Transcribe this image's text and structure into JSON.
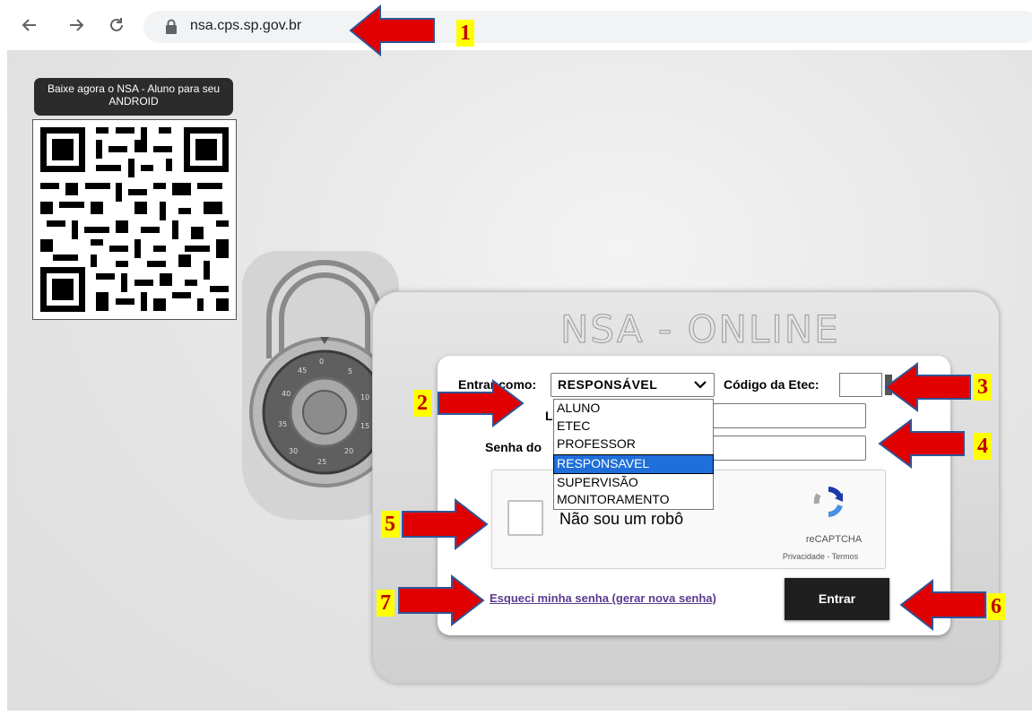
{
  "browser": {
    "url": "nsa.cps.sp.gov.br"
  },
  "qr": {
    "banner_text": "Baixe agora o NSA - Aluno para seu ANDROID"
  },
  "panel": {
    "title": "NSA - ONLINE"
  },
  "form": {
    "role_label": "Entrar como:",
    "role_selected": "RESPONSÁVEL",
    "etec_code_label": "Código da Etec:",
    "login_label": "L",
    "password_label": "Senha do",
    "role_options": [
      "ALUNO",
      "ETEC",
      "PROFESSOR",
      "RESPONSAVEL",
      "SUPERVISÃO",
      "MONITORAMENTO"
    ],
    "role_highlighted_index": 3
  },
  "captcha": {
    "text": "Não sou um robô",
    "brand": "reCAPTCHA",
    "links": "Privacidade - Termos"
  },
  "actions": {
    "forgot_password": "Esqueci minha senha (gerar nova senha)",
    "submit": "Entrar"
  },
  "annotations": {
    "markers": [
      "1",
      "2",
      "3",
      "4",
      "5",
      "6",
      "7"
    ],
    "arrow_color": "#e00000",
    "marker_bg": "#ffff00",
    "marker_color": "#c00000"
  }
}
